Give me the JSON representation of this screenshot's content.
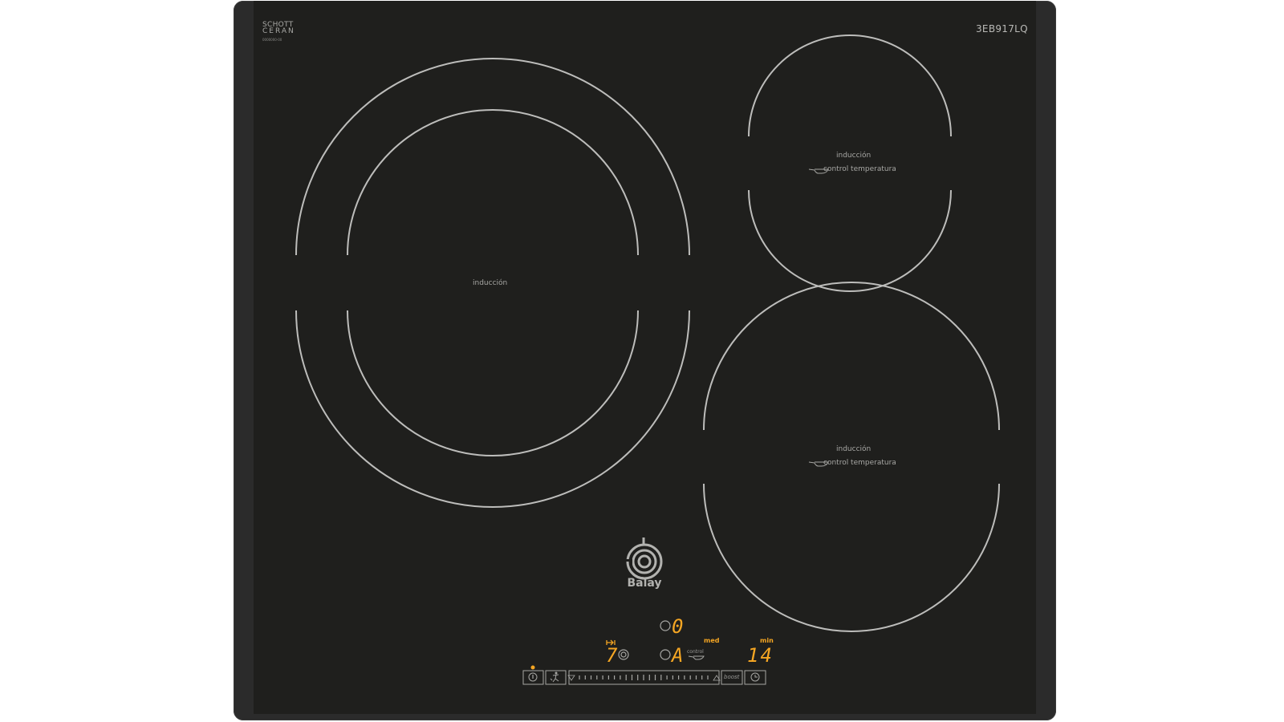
{
  "hob": {
    "model": "3EB917LQ",
    "glass_brand": {
      "line1": "SCHOTT",
      "line2": "CERAN",
      "fine_print": "0000000-00"
    },
    "logo": {
      "name": "Balay",
      "icon": "balay-spiral-logo-icon"
    },
    "zones": {
      "left_large": {
        "label": "inducción"
      },
      "top_right": {
        "label": "inducción",
        "feature": "control temperatura"
      },
      "bottom_right": {
        "label": "inducción",
        "feature": "control temperatura"
      }
    },
    "controls": {
      "zone_display_top": "0",
      "zone_display_bottom": "A",
      "power_level": "7",
      "timer_value": "14",
      "timer_unit": "min",
      "temp_mode": "med",
      "temp_control_label": "control",
      "boost_label": "boost",
      "buttons": {
        "power": "power-icon",
        "child_lock": "child-lock-icon",
        "timer": "clock-icon",
        "pan_size": "pan-size-icon",
        "sensor": "frying-pan-icon"
      }
    },
    "colors": {
      "glass": "#1f1f1d",
      "frame": "#2b2b2b",
      "ring": "#bdbdbb",
      "display": "#f5a623"
    }
  }
}
